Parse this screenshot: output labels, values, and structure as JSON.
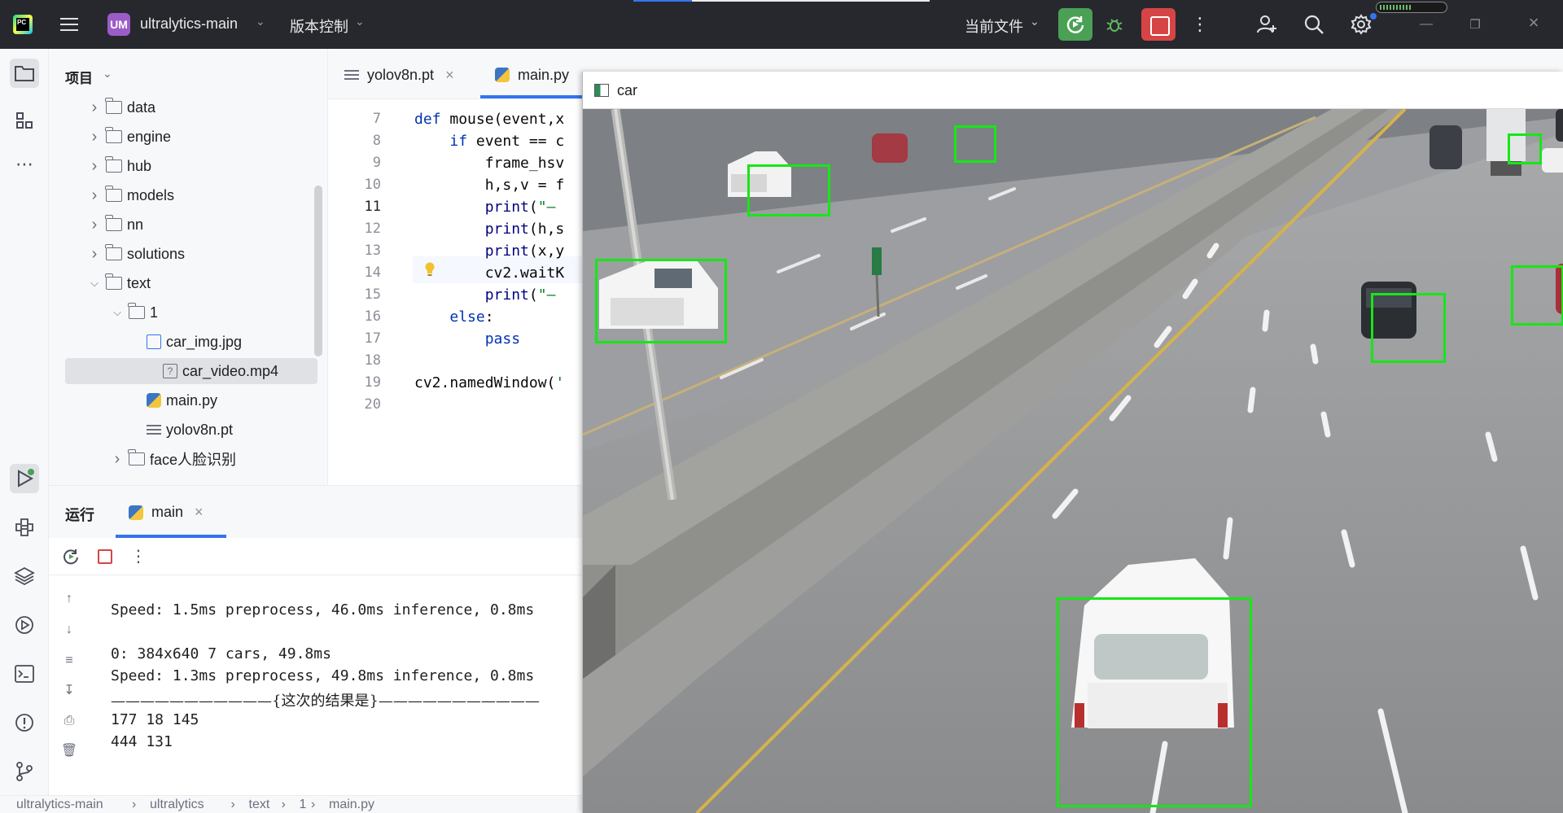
{
  "titlebar": {
    "project_badge": "UM",
    "project_name": "ultralytics-main",
    "vcs_label": "版本控制",
    "run_config": "当前文件"
  },
  "project_panel": {
    "header": "项目",
    "tree": [
      {
        "label": "data",
        "type": "folder",
        "depth": 0,
        "expanded": false
      },
      {
        "label": "engine",
        "type": "folder",
        "depth": 0,
        "expanded": false
      },
      {
        "label": "hub",
        "type": "folder",
        "depth": 0,
        "expanded": false
      },
      {
        "label": "models",
        "type": "folder",
        "depth": 0,
        "expanded": false
      },
      {
        "label": "nn",
        "type": "folder",
        "depth": 0,
        "expanded": false
      },
      {
        "label": "solutions",
        "type": "folder",
        "depth": 0,
        "expanded": false
      },
      {
        "label": "text",
        "type": "folder",
        "depth": 0,
        "expanded": true
      },
      {
        "label": "1",
        "type": "folder",
        "depth": 1,
        "expanded": true
      },
      {
        "label": "car_img.jpg",
        "type": "image",
        "depth": 2
      },
      {
        "label": "car_video.mp4",
        "type": "unknown",
        "depth": 2,
        "selected": true
      },
      {
        "label": "main.py",
        "type": "python",
        "depth": 2
      },
      {
        "label": "yolov8n.pt",
        "type": "text",
        "depth": 2
      },
      {
        "label": "face人脸识别",
        "type": "folder",
        "depth": 1,
        "expanded": false
      }
    ]
  },
  "editor": {
    "tabs": [
      {
        "label": "yolov8n.pt",
        "icon": "text-file-icon",
        "active": false
      },
      {
        "label": "main.py",
        "icon": "python-icon",
        "active": true
      }
    ],
    "lines": [
      {
        "n": "7",
        "code": "def mouse(event,x"
      },
      {
        "n": "8",
        "code": "    if event == c"
      },
      {
        "n": "9",
        "code": "        frame_hsv"
      },
      {
        "n": "10",
        "code": "        h,s,v = f"
      },
      {
        "n": "11",
        "code": "        print(\"—"
      },
      {
        "n": "12",
        "code": "        print(h,s"
      },
      {
        "n": "13",
        "code": "        print(x,y"
      },
      {
        "n": "14",
        "code": "        cv2.waitK"
      },
      {
        "n": "15",
        "code": "        print(\"—"
      },
      {
        "n": "16",
        "code": "    else:"
      },
      {
        "n": "17",
        "code": "        pass"
      },
      {
        "n": "18",
        "code": ""
      },
      {
        "n": "19",
        "code": "cv2.namedWindow('"
      },
      {
        "n": "20",
        "code": ""
      }
    ],
    "current_line": "11"
  },
  "run_panel": {
    "title": "运行",
    "tab_label": "main",
    "console": [
      "Speed: 1.5ms preprocess, 46.0ms inference, 0.8ms",
      "",
      "0: 384x640 7 cars, 49.8ms",
      "Speed: 1.3ms preprocess, 49.8ms inference, 0.8ms",
      "———————————{这次的结果是}———————————",
      "177 18 145",
      "444 131"
    ]
  },
  "statusbar": {
    "breadcrumb": [
      "ultralytics-main",
      "ultralytics",
      "text",
      "1",
      "main.py"
    ]
  },
  "car_window": {
    "title": "car",
    "detections": 7
  },
  "colors": {
    "titlebar_bg": "#27282e",
    "accent": "#3574f0",
    "run_green": "#4aa055",
    "stop_red": "#d64545",
    "detection_box": "#17e617"
  }
}
